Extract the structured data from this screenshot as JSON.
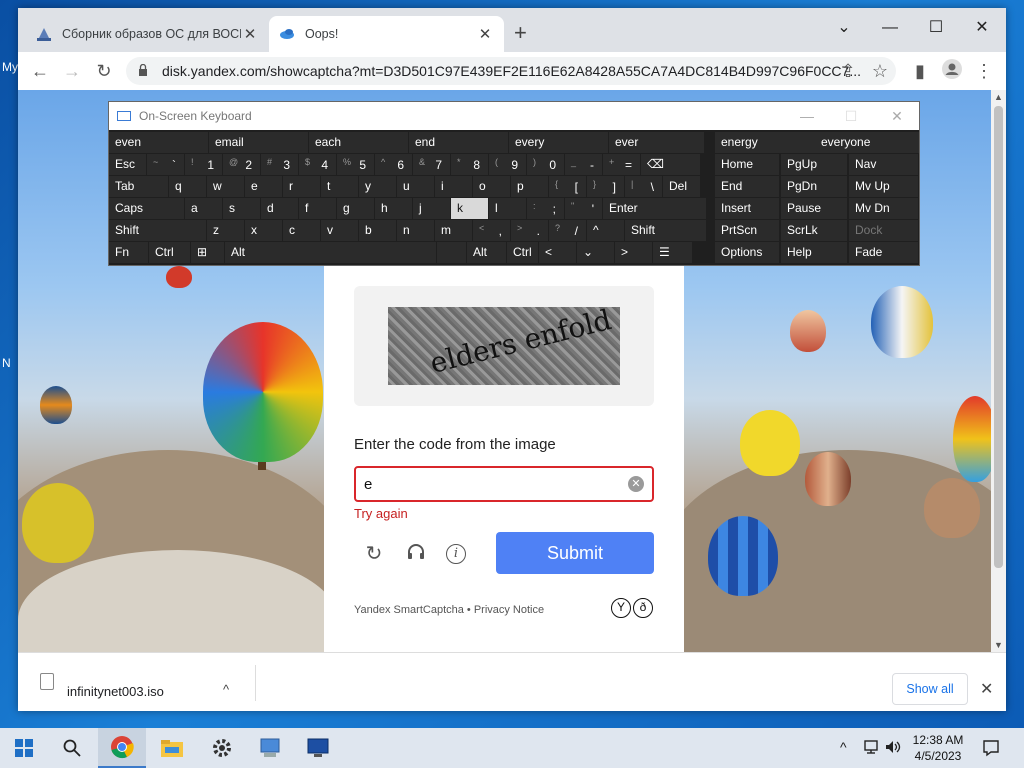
{
  "desktop": {
    "frag_my": "My",
    "frag_n": "N"
  },
  "browser": {
    "tabs": [
      {
        "title": "Сборник образов ОС для ВОСН",
        "close": "✕"
      },
      {
        "title": "Oops!",
        "close": "✕"
      }
    ],
    "new_tab": "+",
    "window_buttons": {
      "dropdown": "⌄",
      "minimize": "—",
      "maximize": "☐",
      "close": "✕"
    },
    "toolbar": {
      "back": "←",
      "forward": "→",
      "reload": "↻",
      "url": "disk.yandex.com/showcaptcha?mt=D3D501C97E439EF2E116E62A8428A55CA7A4DC814B4D997C96F0CC7...",
      "share": "⇪",
      "bookmark": "☆",
      "sidepanel": "▮",
      "menu": "⋮"
    }
  },
  "osk": {
    "title": "On-Screen Keyboard",
    "controls": {
      "minimize": "—",
      "maximize": "☐",
      "close": "✕"
    },
    "suggestions": [
      "even",
      "email",
      "each",
      "end",
      "every",
      "ever"
    ],
    "side_suggestions": [
      "energy",
      "everyone"
    ],
    "row1": [
      {
        "m": "Esc"
      },
      {
        "s": "~",
        "m": "`"
      },
      {
        "s": "!",
        "m": "1"
      },
      {
        "s": "@",
        "m": "2"
      },
      {
        "s": "#",
        "m": "3"
      },
      {
        "s": "$",
        "m": "4"
      },
      {
        "s": "%",
        "m": "5"
      },
      {
        "s": "^",
        "m": "6"
      },
      {
        "s": "&",
        "m": "7"
      },
      {
        "s": "*",
        "m": "8"
      },
      {
        "s": "(",
        "m": "9"
      },
      {
        "s": ")",
        "m": "0"
      },
      {
        "s": "_",
        "m": "-"
      },
      {
        "s": "+",
        "m": "="
      },
      {
        "m": "⌫"
      }
    ],
    "row2": [
      {
        "m": "Tab"
      },
      {
        "m": "q"
      },
      {
        "m": "w"
      },
      {
        "m": "e"
      },
      {
        "m": "r"
      },
      {
        "m": "t"
      },
      {
        "m": "y"
      },
      {
        "m": "u"
      },
      {
        "m": "i"
      },
      {
        "m": "o"
      },
      {
        "m": "p"
      },
      {
        "s": "{",
        "m": "["
      },
      {
        "s": "}",
        "m": "]"
      },
      {
        "s": "|",
        "m": "\\"
      },
      {
        "m": "Del"
      }
    ],
    "row3": [
      {
        "m": "Caps"
      },
      {
        "m": "a"
      },
      {
        "m": "s"
      },
      {
        "m": "d"
      },
      {
        "m": "f"
      },
      {
        "m": "g"
      },
      {
        "m": "h"
      },
      {
        "m": "j"
      },
      {
        "m": "k"
      },
      {
        "m": "l"
      },
      {
        "s": ":",
        "m": ";"
      },
      {
        "s": "\"",
        "m": "'"
      },
      {
        "m": "Enter"
      }
    ],
    "row4": [
      {
        "m": "Shift"
      },
      {
        "m": "z"
      },
      {
        "m": "x"
      },
      {
        "m": "c"
      },
      {
        "m": "v"
      },
      {
        "m": "b"
      },
      {
        "m": "n"
      },
      {
        "m": "m"
      },
      {
        "s": "<",
        "m": ","
      },
      {
        "s": ">",
        "m": "."
      },
      {
        "s": "?",
        "m": "/"
      },
      {
        "m": "^"
      },
      {
        "m": "Shift"
      }
    ],
    "row5": [
      {
        "m": "Fn"
      },
      {
        "m": "Ctrl"
      },
      {
        "m": "⊞"
      },
      {
        "m": "Alt"
      },
      {
        "m": ""
      },
      {
        "m": "Alt"
      },
      {
        "m": "Ctrl"
      },
      {
        "m": "<"
      },
      {
        "m": "⌄"
      },
      {
        "m": ">"
      },
      {
        "m": "☰"
      }
    ],
    "nav": [
      [
        "Home",
        "PgUp",
        "Nav"
      ],
      [
        "End",
        "PgDn",
        "Mv Up"
      ],
      [
        "Insert",
        "Pause",
        "Mv Dn"
      ],
      [
        "PrtScn",
        "ScrLk",
        "Dock"
      ],
      [
        "Options",
        "Help",
        "Fade"
      ]
    ]
  },
  "captcha": {
    "image_text": "elders enfold",
    "prompt": "Enter the code from the image",
    "input_value": "e",
    "clear_icon": "✕",
    "error": "Try again",
    "refresh": "↻",
    "audio": "🎧",
    "info": "i",
    "submit": "Submit",
    "footnote": "Yandex SmartCaptcha • Privacy Notice",
    "logo1": "Y",
    "logo2": "ð"
  },
  "downloads": {
    "file": "infinitynet003.iso",
    "chevron": "^",
    "show_all": "Show all",
    "close": "✕"
  },
  "taskbar": {
    "start": "⊞",
    "search": "⚲",
    "tray_up": "^",
    "tray_net": "▭",
    "tray_vol": "🔊",
    "time": "12:38 AM",
    "date": "4/5/2023",
    "notif": "▭"
  },
  "colors": {
    "accent": "#4f81f5",
    "error": "#c62121",
    "osk_bg": "#1f1f1f"
  }
}
